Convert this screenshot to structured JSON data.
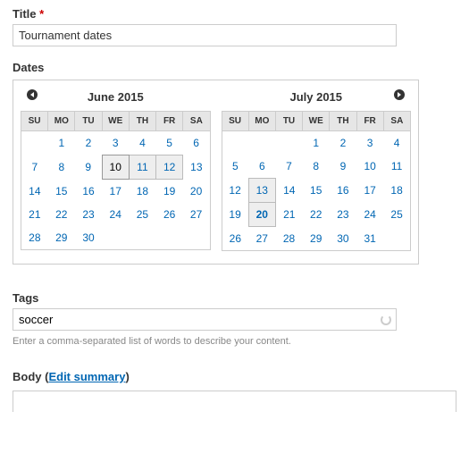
{
  "title": {
    "label": "Title",
    "value": "Tournament dates"
  },
  "dates": {
    "label": "Dates",
    "calendars": [
      {
        "month_label": "June 2015",
        "headers": [
          "SU",
          "MO",
          "TU",
          "WE",
          "TH",
          "FR",
          "SA"
        ],
        "weeks": [
          [
            null,
            1,
            2,
            3,
            4,
            5,
            6
          ],
          [
            7,
            8,
            9,
            10,
            11,
            12,
            13
          ],
          [
            14,
            15,
            16,
            17,
            18,
            19,
            20
          ],
          [
            21,
            22,
            23,
            24,
            25,
            26,
            27
          ],
          [
            28,
            29,
            30,
            null,
            null,
            null,
            null
          ]
        ],
        "today": 10,
        "range": [
          11,
          12
        ]
      },
      {
        "month_label": "July 2015",
        "headers": [
          "SU",
          "MO",
          "TU",
          "WE",
          "TH",
          "FR",
          "SA"
        ],
        "weeks": [
          [
            null,
            null,
            null,
            1,
            2,
            3,
            4
          ],
          [
            5,
            6,
            7,
            8,
            9,
            10,
            11
          ],
          [
            12,
            13,
            14,
            15,
            16,
            17,
            18
          ],
          [
            19,
            20,
            21,
            22,
            23,
            24,
            25
          ],
          [
            26,
            27,
            28,
            29,
            30,
            31,
            null
          ]
        ],
        "today": null,
        "range": [
          13,
          20
        ],
        "bold": [
          20
        ]
      }
    ]
  },
  "tags": {
    "label": "Tags",
    "value": "soccer",
    "help": "Enter a comma-separated list of words to describe your content."
  },
  "body": {
    "label": "Body",
    "edit_summary_label": "Edit summary",
    "value": ""
  }
}
